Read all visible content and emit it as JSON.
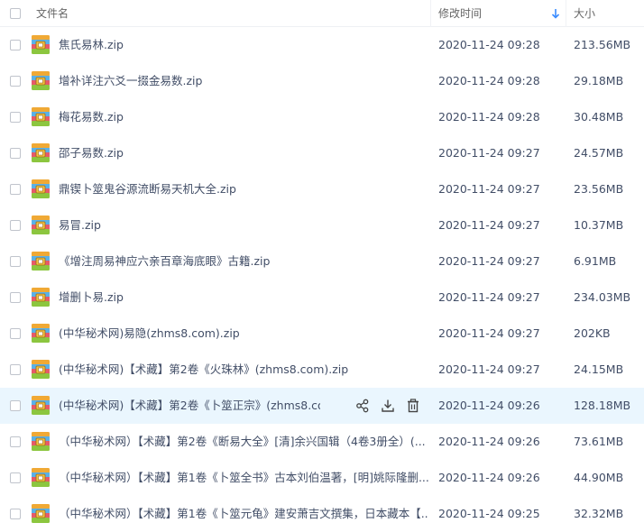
{
  "header": {
    "name_label": "文件名",
    "time_label": "修改时间",
    "size_label": "大小",
    "sort_color": "#3b8cff"
  },
  "files": [
    {
      "name": "焦氏易林.zip",
      "time": "2020-11-24 09:28",
      "size": "213.56MB"
    },
    {
      "name": "增补详注六爻一掇金易数.zip",
      "time": "2020-11-24 09:28",
      "size": "29.18MB"
    },
    {
      "name": "梅花易数.zip",
      "time": "2020-11-24 09:28",
      "size": "30.48MB"
    },
    {
      "name": "邵子易数.zip",
      "time": "2020-11-24 09:27",
      "size": "24.57MB"
    },
    {
      "name": "鼎锲卜筮鬼谷源流断易天机大全.zip",
      "time": "2020-11-24 09:27",
      "size": "23.56MB"
    },
    {
      "name": "易冒.zip",
      "time": "2020-11-24 09:27",
      "size": "10.37MB"
    },
    {
      "name": "《增注周易神应六亲百章海底眼》古籍.zip",
      "time": "2020-11-24 09:27",
      "size": "6.91MB"
    },
    {
      "name": "增删卜易.zip",
      "time": "2020-11-24 09:27",
      "size": "234.03MB"
    },
    {
      "name": "(中华秘术网)易隐(zhms8.com).zip",
      "time": "2020-11-24 09:27",
      "size": "202KB"
    },
    {
      "name": "(中华秘术网)【术藏】第2卷《火珠林》(zhms8.com).zip",
      "time": "2020-11-24 09:27",
      "size": "24.15MB"
    },
    {
      "name": "(中华秘术网)【术藏】第2卷《卜筮正宗》(zhms8.co...",
      "time": "2020-11-24 09:26",
      "size": "128.18MB"
    },
    {
      "name": "（中华秘术网）【术藏】第2卷《断易大全》[清]余兴国辑（4卷3册全）(...",
      "time": "2020-11-24 09:26",
      "size": "73.61MB"
    },
    {
      "name": "（中华秘术网）【术藏】第1卷《卜筮全书》古本刘伯温著，[明]姚际隆删...",
      "time": "2020-11-24 09:26",
      "size": "44.90MB"
    },
    {
      "name": "（中华秘术网）【术藏】第1卷《卜筮元龟》建安萧吉文撰集，日本藏本【...",
      "time": "2020-11-24 09:25",
      "size": "32.32MB"
    }
  ]
}
